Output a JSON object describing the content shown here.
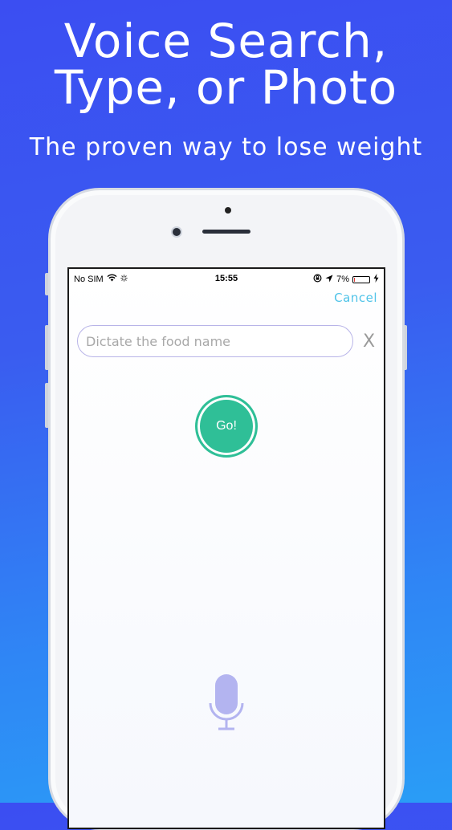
{
  "promo": {
    "headline_line1": "Voice Search,",
    "headline_line2": "Type, or Photo",
    "subheadline": "The proven way to lose weight"
  },
  "status_bar": {
    "carrier": "No SIM",
    "time": "15:55",
    "battery_percent": "7%",
    "battery_level": 0.07,
    "icons": [
      "wifi-icon",
      "loading-spinner-icon",
      "orientation-lock-icon",
      "location-arrow-icon",
      "battery-icon",
      "charging-bolt-icon"
    ]
  },
  "screen": {
    "cancel_label": "Cancel",
    "search_placeholder": "Dictate the food name",
    "search_value": "",
    "clear_label": "X",
    "go_label": "Go!",
    "mic_icon": "microphone-icon"
  },
  "colors": {
    "accent_cancel": "#4fc3e8",
    "go_button": "#2fbf97",
    "mic": "#b3b4f0",
    "battery_low": "#e53935"
  }
}
